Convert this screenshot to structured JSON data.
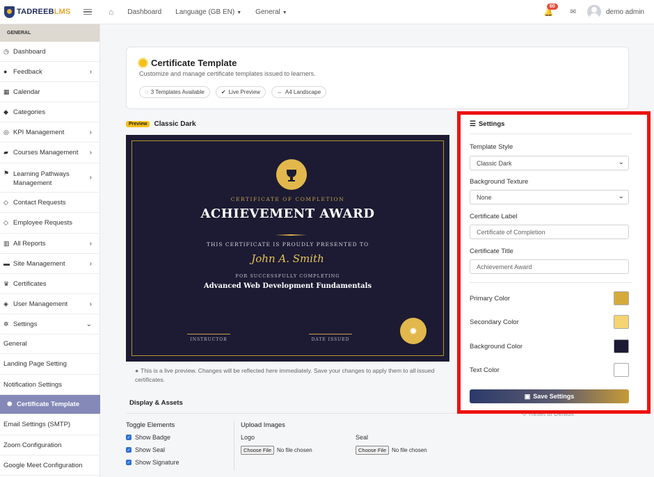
{
  "topbar": {
    "logo_prefix": "TADREEB",
    "logo_suffix": "LMS",
    "nav": [
      {
        "label": "Dashboard"
      },
      {
        "label": "Language (GB EN)"
      },
      {
        "label": "General"
      }
    ],
    "notification_count": "60",
    "user_name": "demo admin"
  },
  "sidebar": {
    "section": "GENERAL",
    "items": [
      {
        "label": "Dashboard",
        "icon": "speedometer-icon"
      },
      {
        "label": "Feedback",
        "icon": "chat-icon"
      },
      {
        "label": "Calendar",
        "icon": "calendar-icon"
      },
      {
        "label": "Categories",
        "icon": "tags-icon"
      },
      {
        "label": "KPI Management",
        "icon": "bullseye-icon"
      },
      {
        "label": "Courses Management",
        "icon": "book-icon"
      },
      {
        "label": "Learning Pathways",
        "label2": "Management",
        "icon": "route-icon"
      },
      {
        "label": "Contact Requests",
        "icon": "contact-icon"
      },
      {
        "label": "Employee Requests",
        "icon": "tag-icon"
      },
      {
        "label": "All Reports",
        "icon": "bar-chart-icon"
      },
      {
        "label": "Site Management",
        "icon": "folder-icon"
      },
      {
        "label": "Certificates",
        "icon": "trophy-icon"
      },
      {
        "label": "User Management",
        "icon": "shield-icon"
      },
      {
        "label": "Settings",
        "icon": "gear-icon"
      },
      {
        "label": "General"
      },
      {
        "label": "Landing Page Setting"
      },
      {
        "label": "Notification Settings"
      },
      {
        "label": "Certificate Template",
        "icon": "sun-icon"
      },
      {
        "label": "Email Settings (SMTP)"
      },
      {
        "label": "Zoom Configuration"
      },
      {
        "label": "Google Meet Configuration"
      }
    ]
  },
  "header": {
    "title": "Certificate Template",
    "subtitle": "Customize and manage certificate templates issued to learners.",
    "pills": [
      "3  Templates Available",
      "Live Preview",
      "A4 Landscape"
    ]
  },
  "preview": {
    "badge": "Preview",
    "name": "Classic Dark",
    "certificate": {
      "label": "CERTIFICATE OF COMPLETION",
      "title": "ACHIEVEMENT AWARD",
      "presented": "THIS CERTIFICATE IS PROUDLY PRESENTED TO",
      "recipient": "John A. Smith",
      "for_text": "FOR SUCCESSFULLY COMPLETING",
      "course": "Advanced Web Development Fundamentals",
      "sig_instructor": "INSTRUCTOR",
      "sig_date": "DATE ISSUED"
    },
    "note": "This is a live preview. Changes will be reflected here immediately. Save your changes to apply them to all issued certificates."
  },
  "display": {
    "title": "Display & Assets",
    "toggle_title": "Toggle Elements",
    "toggles": [
      "Show Badge",
      "Show Seal",
      "Show Signature"
    ],
    "upload_title": "Upload Images",
    "logo_label": "Logo",
    "seal_label": "Seal",
    "file_button": "Choose File",
    "no_file": "No file chosen"
  },
  "settings": {
    "title": "Settings",
    "template_style_label": "Template Style",
    "template_style_value": "Classic Dark",
    "bg_texture_label": "Background Texture",
    "bg_texture_value": "None",
    "cert_label_label": "Certificate Label",
    "cert_label_value": "Certificate of Completion",
    "cert_title_label": "Certificate Title",
    "cert_title_value": "Achievement Award",
    "colors": [
      {
        "label": "Primary Color",
        "value": "#d4ab3a"
      },
      {
        "label": "Secondary Color",
        "value": "#f4d472"
      },
      {
        "label": "Background Color",
        "value": "#1c1b33"
      },
      {
        "label": "Text Color",
        "value": "#ffffff"
      }
    ],
    "save_label": "Save Settings",
    "reset_label": "Reset to Default"
  }
}
